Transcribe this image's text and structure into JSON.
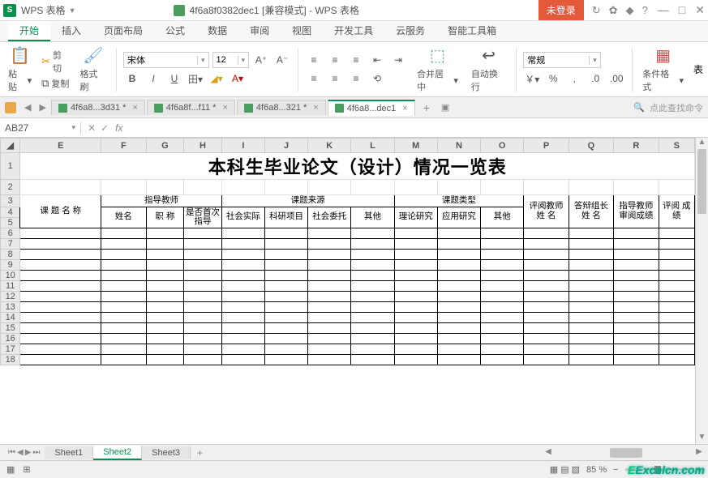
{
  "app": {
    "badge": "S",
    "name": "WPS 表格",
    "doc_title": "4f6a8f0382dec1 [兼容模式] - WPS 表格",
    "login": "未登录"
  },
  "menu": {
    "tabs": [
      "开始",
      "插入",
      "页面布局",
      "公式",
      "数据",
      "审阅",
      "视图",
      "开发工具",
      "云服务",
      "智能工具箱"
    ],
    "active": 0
  },
  "ribbon": {
    "paste": "粘贴",
    "cut": "剪切",
    "copy": "复制",
    "format_painter": "格式刷",
    "font_name": "宋体",
    "font_size": "12",
    "merge": "合并居中",
    "wrap": "自动换行",
    "number_format": "常规",
    "cond_format": "条件格式",
    "table": "表"
  },
  "doctabs": {
    "tabs": [
      {
        "label": "4f6a8...3d31 *",
        "active": false
      },
      {
        "label": "4f6a8f...f11 *",
        "active": false
      },
      {
        "label": "4f6a8...321 *",
        "active": false
      },
      {
        "label": "4f6a8...dec1",
        "active": true
      }
    ],
    "search_hint": "点此查找命令"
  },
  "formula_bar": {
    "cell_ref": "AB27",
    "fx": "fx",
    "value": ""
  },
  "chart_data": {
    "type": "table",
    "title": "本科生毕业论文（设计）情况一览表",
    "columns_visible": [
      "E",
      "F",
      "G",
      "H",
      "I",
      "J",
      "K",
      "L",
      "M",
      "N",
      "O",
      "P",
      "Q",
      "R",
      "S"
    ],
    "rows_visible": [
      1,
      2,
      3,
      4,
      5,
      6,
      7,
      8,
      9,
      10,
      11,
      12,
      13,
      14,
      15,
      16,
      17,
      18
    ],
    "header_groups": [
      {
        "label": "课 题 名 称",
        "span": 1,
        "sub": []
      },
      {
        "label": "指导教师",
        "span": 3,
        "sub": [
          "姓名",
          "职 称",
          "是否首次指导"
        ]
      },
      {
        "label": "课题来源",
        "span": 4,
        "sub": [
          "社会实际",
          "科研项目",
          "社会委托",
          "其他"
        ]
      },
      {
        "label": "课题类型",
        "span": 3,
        "sub": [
          "理论研究",
          "应用研究",
          "其他"
        ]
      },
      {
        "label": "",
        "span": 4,
        "sub": [
          "评阅教师 姓 名",
          "答辩组长 姓 名",
          "指导教师 审阅成绩",
          "评阅 成绩"
        ]
      }
    ],
    "data_rows": []
  },
  "sheets": {
    "tabs": [
      "Sheet1",
      "Sheet2",
      "Sheet3"
    ],
    "active": 1
  },
  "status": {
    "zoom": "85 %",
    "watermark": "Excelcn.com"
  }
}
